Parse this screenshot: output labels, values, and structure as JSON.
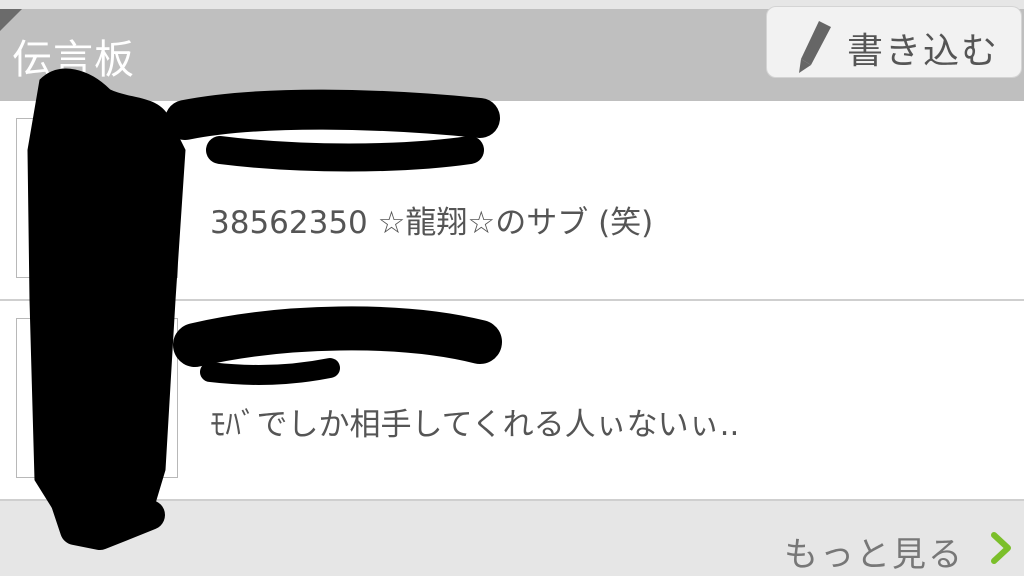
{
  "header": {
    "title": "伝言板",
    "write_button_label": "書き込む",
    "write_icon": "pencil-icon"
  },
  "posts": [
    {
      "message": "38562350 ☆龍翔☆のサブ (笑)",
      "author_redacted": true,
      "thumbnail_redacted": true
    },
    {
      "message": "ﾓﾊﾞでしか相手してくれる人ぃないぃ..",
      "author_redacted": true,
      "thumbnail_redacted": true
    }
  ],
  "footer": {
    "more_label": "もっと見る",
    "more_icon": "chevron-right-icon"
  },
  "colors": {
    "header_bg": "#bfbfbf",
    "accent_green": "#7bbf2a",
    "text": "#555555",
    "redaction": "#000000"
  }
}
